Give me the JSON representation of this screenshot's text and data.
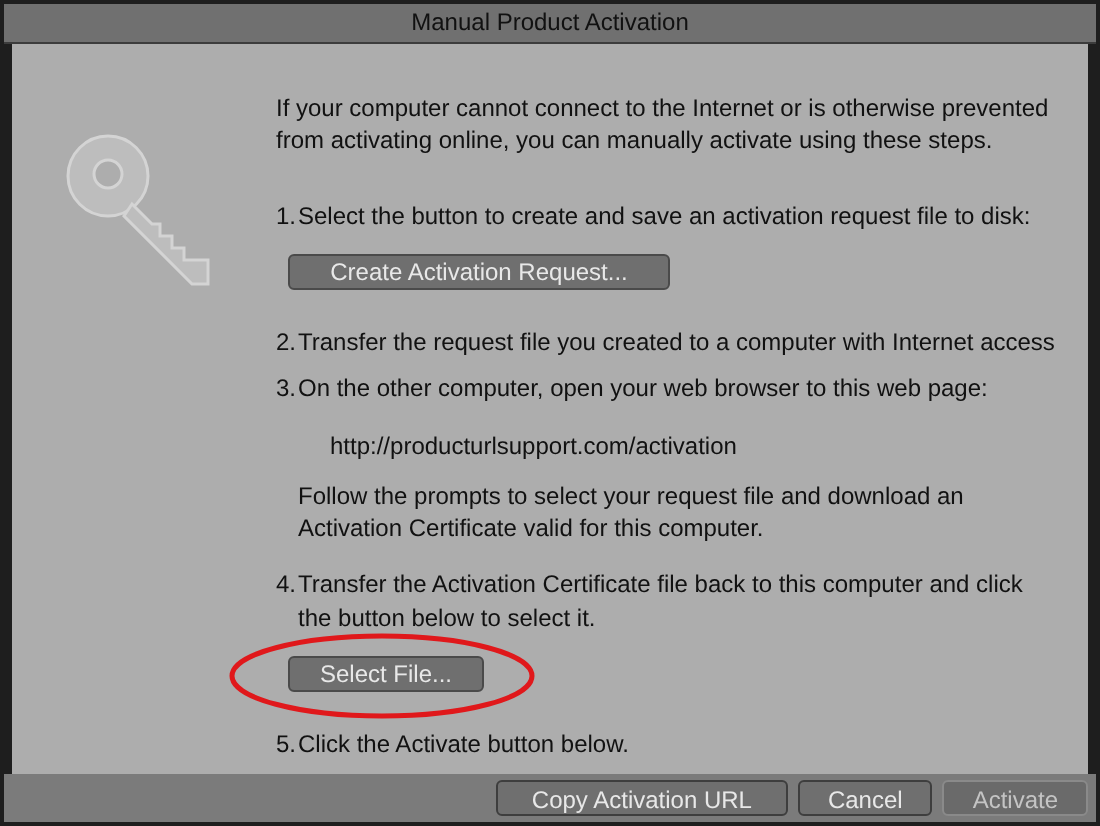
{
  "window": {
    "title": "Manual Product Activation"
  },
  "content": [
    {
      "kind": "paragraph",
      "text": "If your computer cannot connect to the Internet or is otherwise prevented from activating online, you can manually activate using these steps."
    },
    {
      "kind": "step",
      "number": "1.",
      "text": "Select the button to create and save an activation request file to disk:"
    },
    {
      "kind": "button",
      "text": "Create Activation Request...",
      "highlighted": false
    },
    {
      "kind": "step",
      "number": "2.",
      "text": "Transfer the request file you created to a computer with Internet access"
    },
    {
      "kind": "step",
      "number": "3.",
      "text": "On the other computer, open your web browser to this web page:"
    },
    {
      "kind": "url",
      "text": "http://producturlsupport.com/activation"
    },
    {
      "kind": "note",
      "text": "Follow the prompts to select your request file and download an Activation Certificate valid for this computer."
    },
    {
      "kind": "step",
      "number": "4.",
      "text": "Transfer the Activation Certificate file back to this computer and click the button below to select it."
    },
    {
      "kind": "button",
      "text": "Select File...",
      "highlighted": true
    },
    {
      "kind": "step",
      "number": "5.",
      "text": "Click the Activate button below."
    }
  ],
  "buttons": [
    {
      "label": "Copy Activation URL",
      "disabled": false
    },
    {
      "label": "Cancel",
      "disabled": false
    },
    {
      "label": "Activate",
      "disabled": true
    }
  ]
}
